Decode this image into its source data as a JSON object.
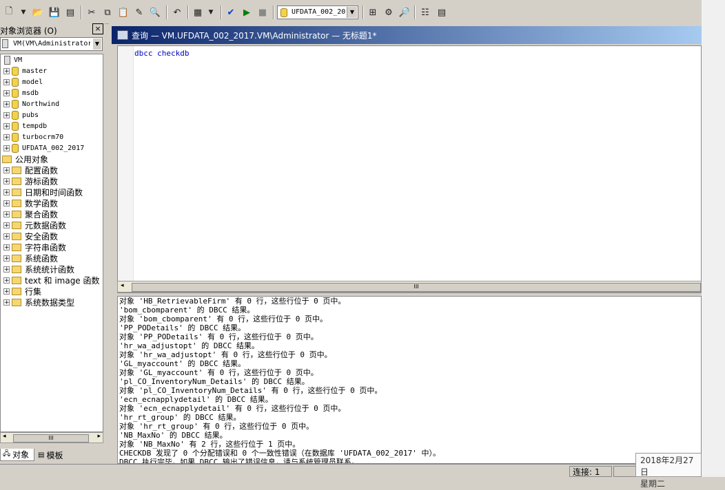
{
  "toolbar": {
    "database_select": "UFDATA_002_20"
  },
  "object_browser": {
    "title": "对象浏览器 (O)",
    "close": "×",
    "server_combo": "VM(VM\\Administrator",
    "root": "VM",
    "databases": [
      "master",
      "model",
      "msdb",
      "Northwind",
      "pubs",
      "tempdb",
      "turbocrm70",
      "UFDATA_002_2017"
    ],
    "common_objects": "公用对象",
    "functions": [
      "配置函数",
      "游标函数",
      "日期和时间函数",
      "数学函数",
      "聚合函数",
      "元数据函数",
      "安全函数",
      "字符串函数",
      "系统函数",
      "系统统计函数",
      "text 和 image 函数",
      "行集",
      "系统数据类型"
    ],
    "tabs": {
      "objects": "对象",
      "templates": "模板"
    }
  },
  "query_window": {
    "title": "查询 — VM.UFDATA_002_2017.VM\\Administrator — 无标题1*",
    "code": "dbcc checkdb",
    "results": [
      "对象 'HB_RetrievableFirm' 有 0 行，这些行位于 0 页中。",
      "'bom_cbomparent' 的 DBCC 结果。",
      "对象 'bom_cbomparent' 有 0 行，这些行位于 0 页中。",
      "'PP_PODetails' 的 DBCC 结果。",
      "对象 'PP_PODetails' 有 0 行，这些行位于 0 页中。",
      "'hr_wa_adjustopt' 的 DBCC 结果。",
      "对象 'hr_wa_adjustopt' 有 0 行，这些行位于 0 页中。",
      "'GL_myaccount' 的 DBCC 结果。",
      "对象 'GL_myaccount' 有 0 行，这些行位于 0 页中。",
      "'pl_CO_InventoryNum_Details' 的 DBCC 结果。",
      "对象 'pl_CO_InventoryNum_Details' 有 0 行，这些行位于 0 页中。",
      "'ecn_ecnapplydetail' 的 DBCC 结果。",
      "对象 'ecn_ecnapplydetail' 有 0 行，这些行位于 0 页中。",
      "'hr_rt_group' 的 DBCC 结果。",
      "对象 'hr_rt_group' 有 0 行，这些行位于 0 页中。",
      "'NB_MaxNo' 的 DBCC 结果。",
      "对象 'NB_MaxNo' 有 2 行，这些行位于 1 页中。",
      "CHECKDB 发现了 0 个分配错误和 0 个一致性错误（在数据库 'UFDATA_002_2017' 中）。",
      "DBCC 执行完毕。如果 DBCC 输出了错误信息，请与系统管理员联系。"
    ]
  },
  "status_bar": {
    "connections": "连接: 1"
  },
  "clock": {
    "date": "2018年2月27日",
    "weekday": "星期二"
  }
}
